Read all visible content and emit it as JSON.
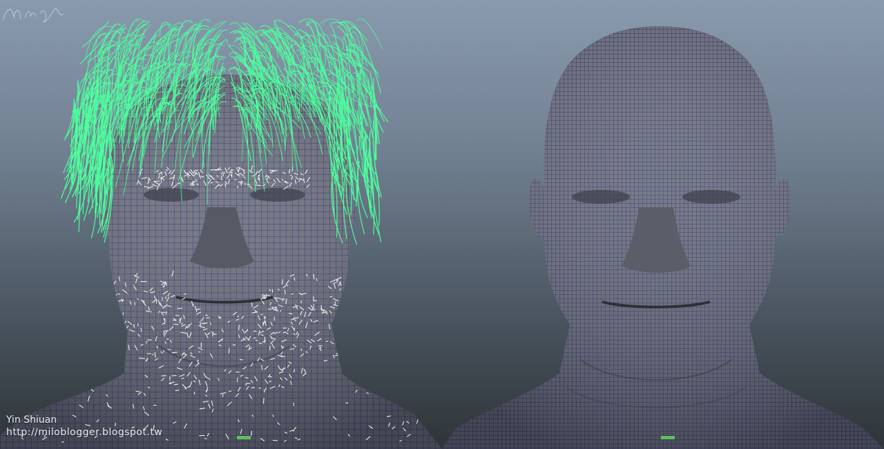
{
  "scene": {
    "title": "",
    "background_top": "#8a9aae",
    "background_bottom": "#2e3438",
    "mesh_fill": "#6b6f7a",
    "wire_color": "#1b1a8c",
    "hair_color": "#4dff9c",
    "stubble_color": "#f0f0f0"
  },
  "models": [
    {
      "label": "head-with-hair-guides",
      "has_hair": true
    },
    {
      "label": "bald-head-wireframe",
      "has_hair": false
    }
  ],
  "credits": {
    "author": "Yin Shiuan",
    "url": "http://miloblogger.blogspot.tw"
  },
  "signature": {
    "icon": "signature-mark"
  }
}
